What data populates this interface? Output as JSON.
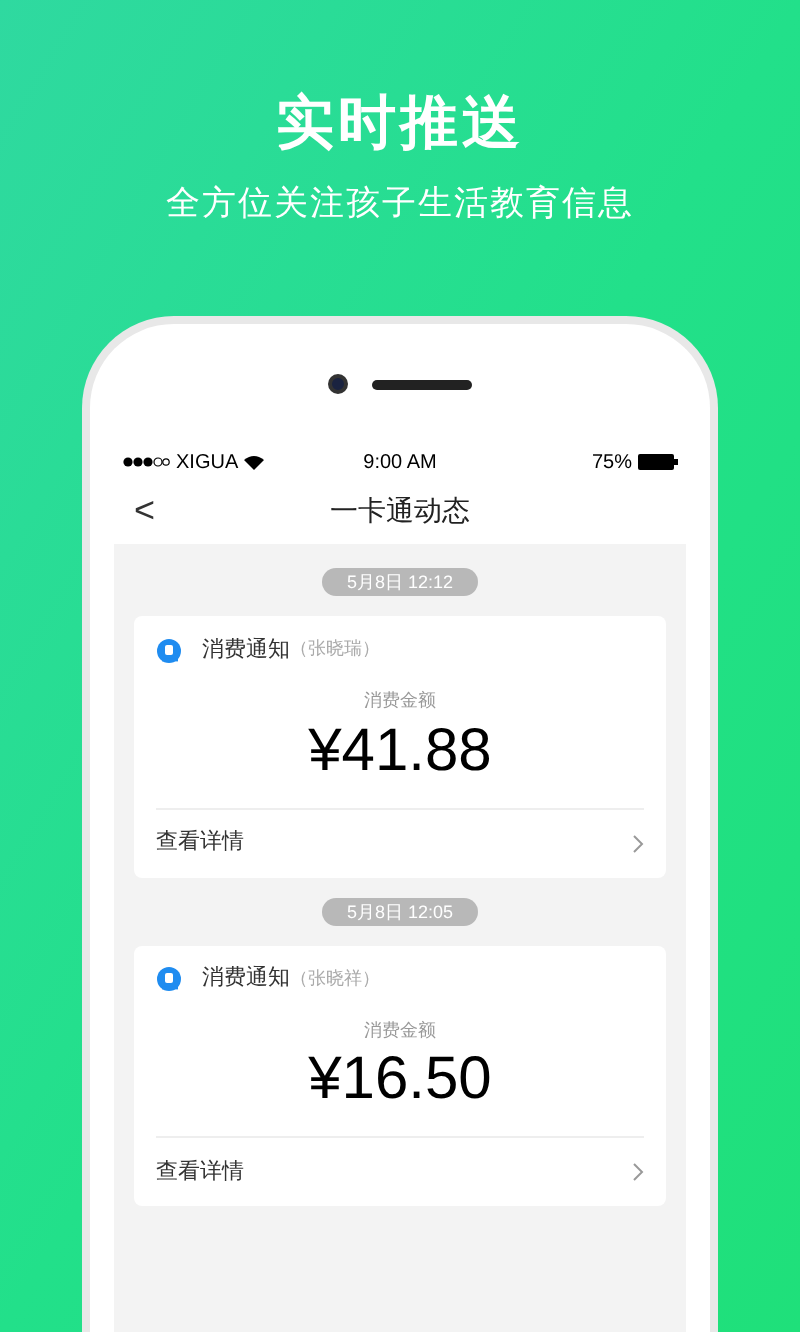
{
  "headline": "实时推送",
  "subtitle": "全方位关注孩子生活教育信息",
  "status_bar": {
    "carrier": "XIGUA",
    "time": "9:00 AM",
    "battery": "75%"
  },
  "nav": {
    "back": "<",
    "title": "一卡通动态"
  },
  "messages": [
    {
      "time": "5月8日 12:12",
      "title": "消费通知",
      "student": "（张晓瑞）",
      "amount_label": "消费金额",
      "amount": "¥41.88",
      "link": "查看详情"
    },
    {
      "time": "5月8日 12:05",
      "title": "消费通知",
      "student": "（张晓祥）",
      "amount_label": "消费金额",
      "amount": "¥16.50",
      "link": "查看详情"
    }
  ]
}
